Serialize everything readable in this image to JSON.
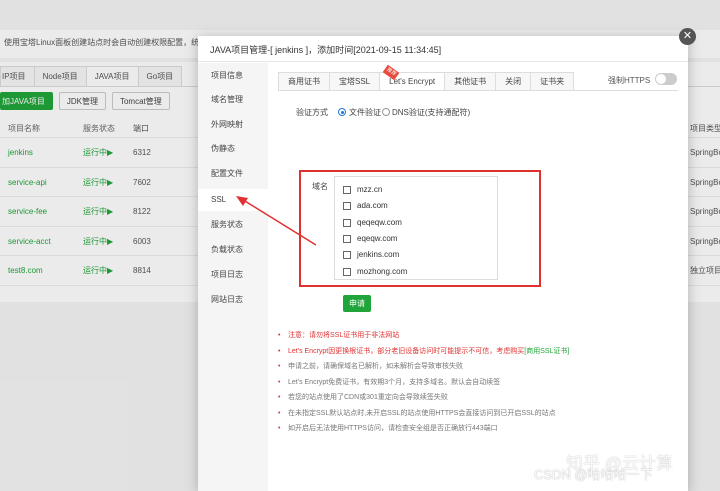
{
  "background": {
    "notice": "使用宝塔Linux面板创建站点时会自动创建权限配置，统一",
    "tabs": [
      "IP项目",
      "Node项目",
      "JAVA项目",
      "Go项目"
    ],
    "buttons": [
      "加JAVA项目",
      "JDK管理",
      "Tomcat管理"
    ],
    "columns": [
      "项目名称",
      "服务状态",
      "端口",
      "项目类型"
    ],
    "rows": [
      {
        "name": "jenkins",
        "state": "运行中▶",
        "port": "6312",
        "type": "SpringBo"
      },
      {
        "name": "service-api",
        "state": "运行中▶",
        "port": "7602",
        "type": "SpringBo"
      },
      {
        "name": "service-fee",
        "state": "运行中▶",
        "port": "8122",
        "type": "SpringBo"
      },
      {
        "name": "service-acct",
        "state": "运行中▶",
        "port": "6003",
        "type": "SpringBo"
      },
      {
        "name": "test8.com",
        "state": "运行中▶",
        "port": "8814",
        "type": "独立项目"
      }
    ]
  },
  "modal": {
    "title": "JAVA项目管理-[ jenkins ]，添加时间[2021-09-15 11:34:45]",
    "close": "✕",
    "side_menu": [
      "项目信息",
      "域名管理",
      "外网映射",
      "伪静态",
      "配置文件",
      "SSL",
      "服务状态",
      "负载状态",
      "项目日志",
      "网站日志"
    ],
    "sub_tabs": [
      "商用证书",
      "宝塔SSL",
      "Let's Encrypt",
      "其他证书",
      "关闭",
      "证书夹"
    ],
    "badge": "推荐",
    "force_https": "强制HTTPS",
    "verify": {
      "label": "验证方式",
      "file": "文件验证",
      "dns": "DNS验证(支持通配符)"
    },
    "domain_label": "域名",
    "domains": [
      "mzz.cn",
      "ada.com",
      "qeqeqw.com",
      "eqeqw.com",
      "jenkins.com",
      "mozhong.com"
    ],
    "apply": "申请",
    "notes": [
      "注意：请勿将SSL证书用于非法网站",
      "Let's Encrypt因更换根证书，部分老旧设备访问时可能提示不可信，考虑购买",
      "申请之前，请确保域名已解析，如未解析会导致审核失败",
      "Let's Encrypt免费证书，有效期3个月，支持多域名。默认会自动续签",
      "若您的站点使用了CDN或301重定向会导致续签失败",
      "在未指定SSL默认站点时,未开启SSL的站点使用HTTPS会直接访问到已开启SSL的站点",
      "如开启后无法使用HTTPS访问，请检查安全组是否正确放行443端口"
    ],
    "note_link": "[商用SSL证书]"
  },
  "watermark": {
    "zhihu": "知乎 @云计算",
    "csdn": "CSDN @哈哈哈一下"
  }
}
